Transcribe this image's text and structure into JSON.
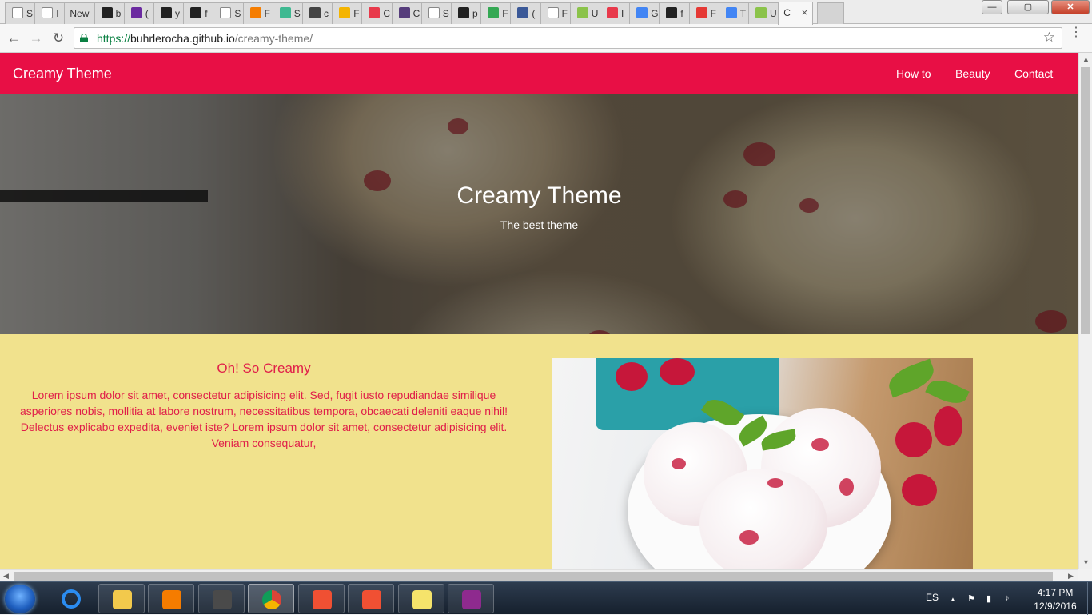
{
  "browser": {
    "tabs": [
      {
        "title": "S",
        "favicon": "page-icon",
        "color": "#ffffff"
      },
      {
        "title": "I",
        "favicon": "page-icon",
        "color": "#ffffff"
      },
      {
        "title": "New",
        "favicon": "none",
        "color": "#ffffff"
      },
      {
        "title": "b",
        "favicon": "github-icon",
        "color": "#222222"
      },
      {
        "title": "(",
        "favicon": "mail-icon",
        "color": "#6b2aa0"
      },
      {
        "title": "y",
        "favicon": "github-icon",
        "color": "#222222"
      },
      {
        "title": "f",
        "favicon": "flag-icon",
        "color": "#222222"
      },
      {
        "title": "S",
        "favicon": "page-icon",
        "color": "#ffffff"
      },
      {
        "title": "F",
        "favicon": "blogger-icon",
        "color": "#f57d00"
      },
      {
        "title": "S",
        "favicon": "slack-icon",
        "color": "#3eb991"
      },
      {
        "title": "c",
        "favicon": "hash-icon",
        "color": "#444444"
      },
      {
        "title": "F",
        "favicon": "slides-icon",
        "color": "#f4b400"
      },
      {
        "title": "C",
        "favicon": "m-icon",
        "color": "#e8394b"
      },
      {
        "title": "C",
        "favicon": "bootstrap-icon",
        "color": "#563d7c"
      },
      {
        "title": "S",
        "favicon": "page-icon",
        "color": "#ffffff"
      },
      {
        "title": "p",
        "favicon": "github-icon",
        "color": "#222222"
      },
      {
        "title": "F",
        "favicon": "px-icon",
        "color": "#34a853"
      },
      {
        "title": "(",
        "favicon": "facebook-icon",
        "color": "#3b5998"
      },
      {
        "title": "F",
        "favicon": "page-icon",
        "color": "#ffffff"
      },
      {
        "title": "U",
        "favicon": "e-icon",
        "color": "#8bc34a"
      },
      {
        "title": "I",
        "favicon": "m-icon",
        "color": "#e8394b"
      },
      {
        "title": "G",
        "favicon": "google-icon",
        "color": "#4285f4"
      },
      {
        "title": "f",
        "favicon": "flag-icon",
        "color": "#222222"
      },
      {
        "title": "F",
        "favicon": "f-icon",
        "color": "#e53935"
      },
      {
        "title": "T",
        "favicon": "translate-icon",
        "color": "#4285f4"
      },
      {
        "title": "U",
        "favicon": "e-icon",
        "color": "#8bc34a"
      },
      {
        "title": "C",
        "favicon": "none",
        "color": "#ffffff",
        "active": true
      }
    ],
    "active_tab_close": "×",
    "window_controls": {
      "minimize": "—",
      "maximize": "▢",
      "close": "✕"
    },
    "url": {
      "scheme": "https://",
      "host": "buhrlerocha.github.io",
      "path": "/creamy-theme/"
    },
    "back": "←",
    "forward": "→",
    "reload": "↻",
    "star": "☆",
    "menu": "⋮"
  },
  "site": {
    "brand": "Creamy Theme",
    "nav": [
      "How to",
      "Beauty",
      "Contact"
    ],
    "hero": {
      "title": "Creamy Theme",
      "subtitle": "The best theme"
    },
    "section": {
      "heading": "Oh! So Creamy",
      "body": "Lorem ipsum dolor sit amet, consectetur adipisicing elit. Sed, fugit iusto repudiandae similique asperiores nobis, mollitia at labore nostrum, necessitatibus tempora, obcaecati deleniti eaque nihil! Delectus explicabo expedita, eveniet iste? Lorem ipsum dolor sit amet, consectetur adipisicing elit. Veniam consequatur,"
    },
    "colors": {
      "primary": "#e80f45",
      "background": "#f1e28d",
      "text_accent": "#e01f49"
    }
  },
  "taskbar": {
    "apps": [
      {
        "name": "internet-explorer-icon",
        "color": "#1e88e5"
      },
      {
        "name": "file-explorer-icon",
        "color": "#f2c94c"
      },
      {
        "name": "media-player-icon",
        "color": "#f57c00"
      },
      {
        "name": "sublime-text-icon",
        "color": "#4a4a4a"
      },
      {
        "name": "chrome-icon",
        "color": "#db4437",
        "active": true
      },
      {
        "name": "git-icon",
        "color": "#f05033"
      },
      {
        "name": "git-gui-icon",
        "color": "#f05033"
      },
      {
        "name": "sticky-notes-icon",
        "color": "#f5e36b"
      },
      {
        "name": "winrar-icon",
        "color": "#8e2a8e"
      }
    ],
    "language": "ES",
    "tray_up": "▲",
    "time": "4:17 PM",
    "date": "12/9/2016"
  }
}
